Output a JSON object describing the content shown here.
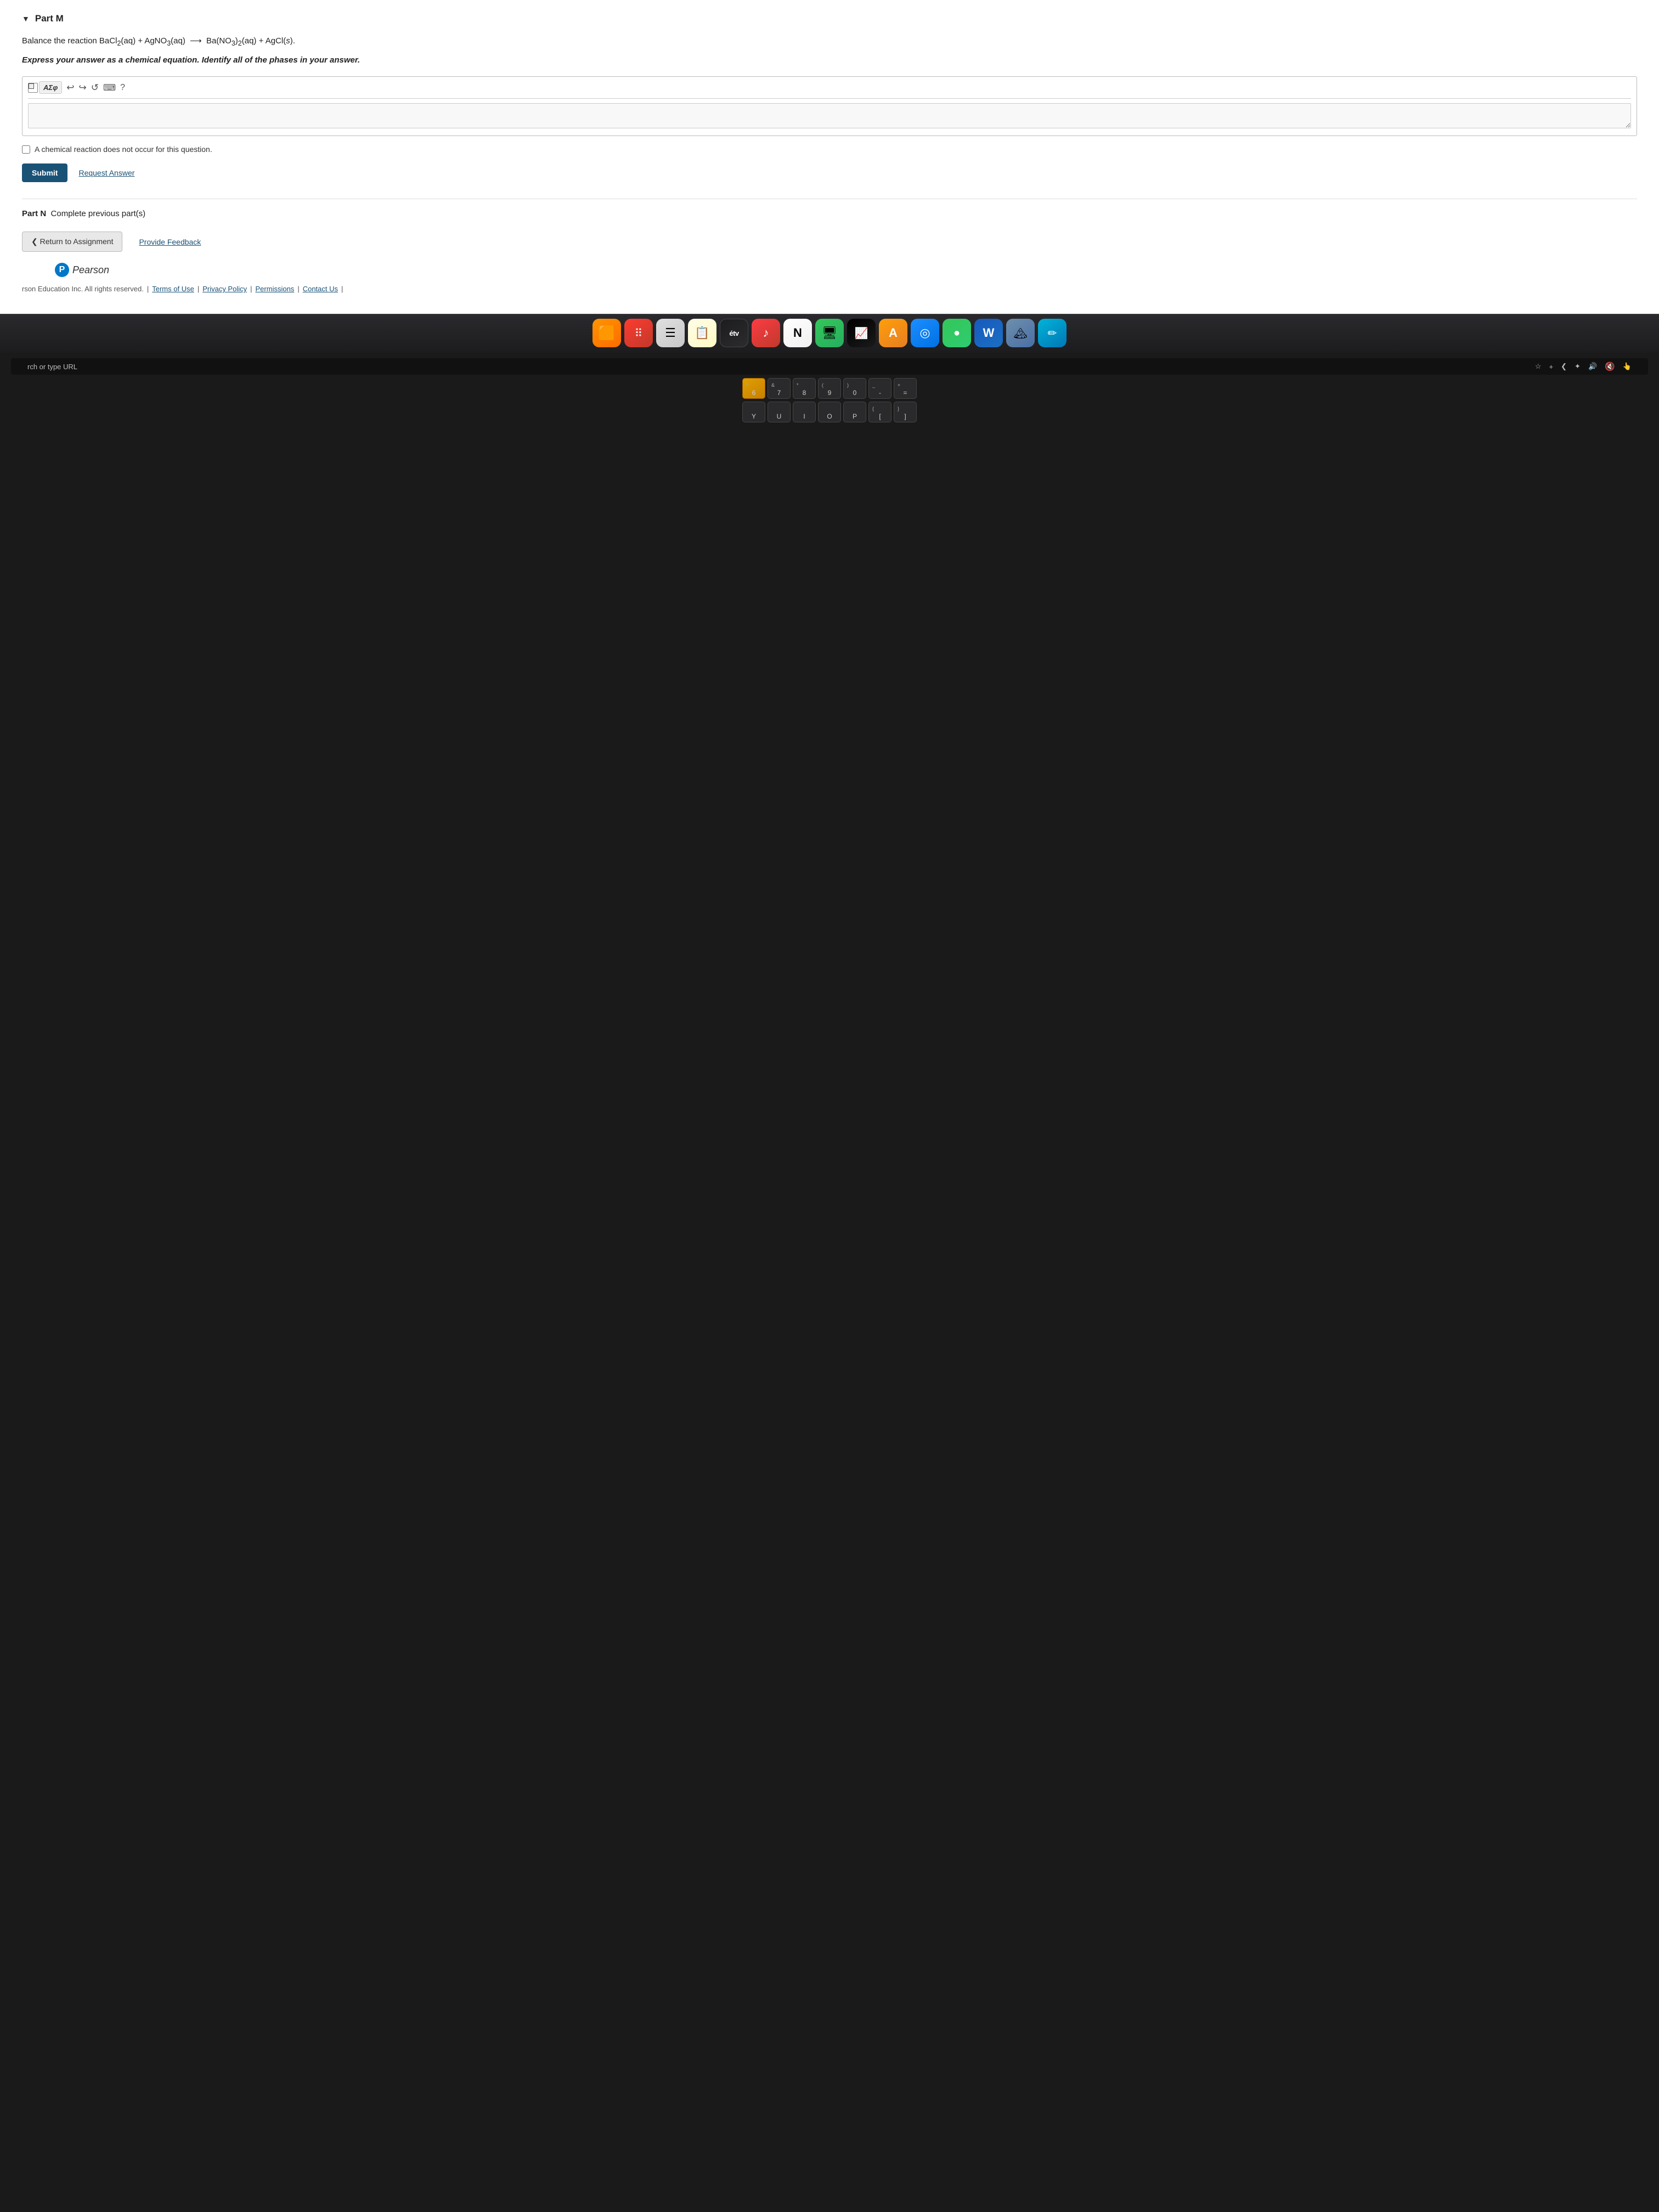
{
  "page": {
    "bg_color": "#ffffff"
  },
  "partM": {
    "label": "Part M",
    "question_line1": "Balance the reaction BaCl₂(aq) + AgNO₃(aq) → Ba(NO₃)₂(aq) + AgCl(s).",
    "question_bold": "Express your answer as a chemical equation. Identify all of the phases in your answer.",
    "toolbar": {
      "math_btn": "AΣφ",
      "undo_label": "↩",
      "redo_label": "↪",
      "reload_label": "↺",
      "keyboard_label": "⌨",
      "help_label": "?"
    },
    "answer_placeholder": "",
    "checkbox_label": "A chemical reaction does not occur for this question.",
    "submit_btn": "Submit",
    "request_answer_btn": "Request Answer"
  },
  "partN": {
    "label": "Part N",
    "sub_label": "Complete previous part(s)"
  },
  "nav": {
    "return_btn": "❮ Return to Assignment",
    "feedback_btn": "Provide Feedback"
  },
  "pearson": {
    "logo_letter": "P",
    "name": "Pearson"
  },
  "footer": {
    "copyright": "rson Education Inc. All rights reserved.",
    "sep": "|",
    "terms": "Terms of Use",
    "privacy": "Privacy Policy",
    "permissions": "Permissions",
    "contact": "Contact Us"
  },
  "dock": {
    "items": [
      {
        "id": "orange-app",
        "emoji": "🟠",
        "label": "App 1",
        "style": "orange"
      },
      {
        "id": "red-dots",
        "emoji": "⠿",
        "label": "App 2",
        "style": "red-dot"
      },
      {
        "id": "list-app",
        "emoji": "☰",
        "label": "Lists",
        "style": "list"
      },
      {
        "id": "notes-app",
        "emoji": "📝",
        "label": "Notes",
        "style": "white-notes"
      },
      {
        "id": "tv-app",
        "emoji": "tv",
        "label": "Apple TV",
        "style": "tv"
      },
      {
        "id": "music-app",
        "emoji": "♪",
        "label": "Music",
        "style": "music"
      },
      {
        "id": "news-app",
        "emoji": "N",
        "label": "News",
        "style": "news"
      },
      {
        "id": "monitor-app",
        "emoji": "⬆",
        "label": "Monitor",
        "style": "monitor"
      },
      {
        "id": "stocks-app",
        "emoji": "📊",
        "label": "Stocks",
        "style": "stocks"
      },
      {
        "id": "remind-app",
        "emoji": "A",
        "label": "Reminders",
        "style": "remind"
      },
      {
        "id": "safari-app",
        "emoji": "◎",
        "label": "Safari",
        "style": "compass"
      },
      {
        "id": "facetime-app",
        "emoji": "●",
        "label": "FaceTime",
        "style": "green-circle"
      },
      {
        "id": "word-app",
        "emoji": "W",
        "label": "Word",
        "style": "word"
      },
      {
        "id": "mountain-app",
        "emoji": "🏔",
        "label": "App",
        "style": "mountain"
      },
      {
        "id": "pencil-app",
        "emoji": "✏",
        "label": "Draw",
        "style": "pencil"
      }
    ]
  },
  "touchbar": {
    "url_text": "rch or type URL",
    "icons_left": [
      "★",
      "+",
      "❮",
      "✦"
    ],
    "icons_right": [
      "🔈",
      "🔇",
      "👆"
    ]
  },
  "keyboard": {
    "rows": [
      {
        "id": "number-row",
        "keys": [
          {
            "top": "^",
            "bottom": "6",
            "style": "orange-key"
          },
          {
            "top": "&",
            "bottom": "7"
          },
          {
            "top": "*",
            "bottom": "8"
          },
          {
            "top": "(",
            "bottom": "9"
          },
          {
            "top": ")",
            "bottom": "0"
          },
          {
            "top": "_",
            "bottom": "-"
          },
          {
            "top": "+",
            "bottom": "="
          }
        ]
      },
      {
        "id": "letter-row",
        "keys": [
          {
            "top": "",
            "bottom": "Y"
          },
          {
            "top": "",
            "bottom": "U"
          },
          {
            "top": "",
            "bottom": "I"
          },
          {
            "top": "",
            "bottom": "O"
          },
          {
            "top": "",
            "bottom": "P"
          },
          {
            "top": "{",
            "bottom": "["
          },
          {
            "top": "}",
            "bottom": "]"
          }
        ]
      }
    ]
  }
}
